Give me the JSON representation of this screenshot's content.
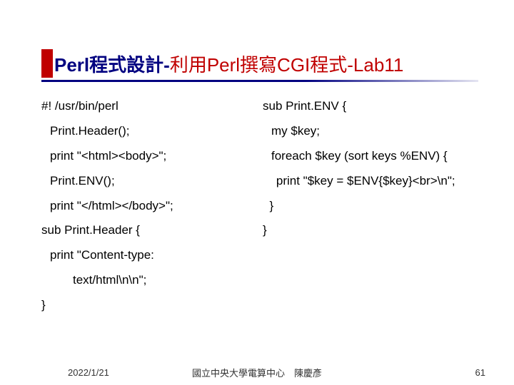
{
  "title": {
    "main": "Perl程式設計-",
    "sub": "利用Perl撰寫CGI程式-Lab11"
  },
  "left": {
    "l1": "#! /usr/bin/perl",
    "l2": "Print.Header();",
    "l3": "print \"<html><body>\";",
    "l4": "Print.ENV();",
    "l5": "print  \"</html></body>\";",
    "l6": "sub Print.Header {",
    "l7": "print \"Content-type:",
    "l8": "text/html\\n\\n\";",
    "l9": "}"
  },
  "right": {
    "l1": "sub Print.ENV {",
    "l2": "my $key;",
    "l3": "foreach $key (sort keys %ENV) {",
    "l4": "    print \"$key = $ENV{$key}<br>\\n\";",
    "l5": "  }",
    "l6": "}"
  },
  "footer": {
    "date": "2022/1/21",
    "center": "國立中央大學電算中心　陳慶彥",
    "page": "61"
  }
}
